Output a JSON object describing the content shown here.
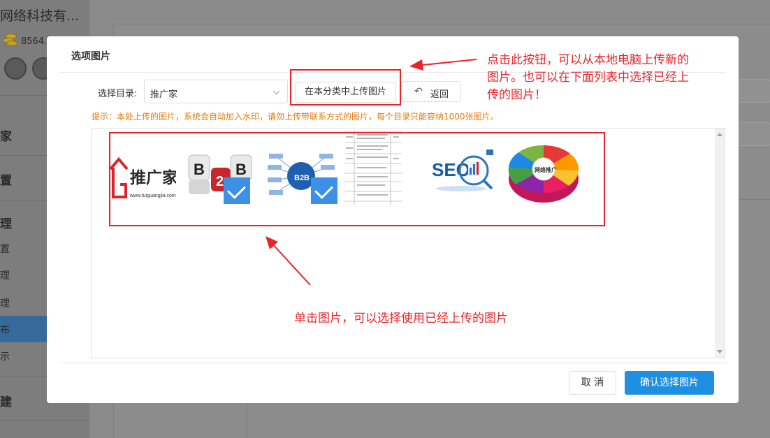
{
  "background": {
    "company_name": "网络科技有...",
    "balance": "8564.",
    "menu": [
      "家",
      "置",
      "理",
      "置",
      "理",
      "理",
      "布",
      "示",
      "建"
    ]
  },
  "modal": {
    "title": "选项图片",
    "directory_label": "选择目录:",
    "directory_value": "推广家",
    "upload_button": "在本分类中上传图片",
    "back_icon": "undo-arrow-icon",
    "back_button": "返回",
    "hint": "提示：本处上传的图片，系统会自动加入水印，请勿上传带联系方式的图片，每个目录只能容纳1000张图片。",
    "images": [
      {
        "name": "tuiguangjia-logo",
        "logo_text": "推广家",
        "url_text": "www.tuiguangjia.com",
        "selected": false
      },
      {
        "name": "b2b-cubes",
        "letters": [
          "B",
          "2",
          "B"
        ],
        "selected": true
      },
      {
        "name": "b2b-network",
        "label": "B2B",
        "selected": true
      },
      {
        "name": "document-table",
        "selected": false
      },
      {
        "name": "seo-chart",
        "label": "SEO",
        "selected": false
      },
      {
        "name": "network-promotion-wheel",
        "label": "网络推广",
        "selected": false
      }
    ],
    "cancel_button": "取 消",
    "confirm_button": "确认选择图片"
  },
  "annotations": {
    "top_note": [
      "点击此按钮，可以从本地电脑上传新的",
      "图片。也可以在下面列表中选择已经上",
      "传的图片！"
    ],
    "bottom_note": "单击图片，可以选择使用已经上传的图片",
    "color": "#e8242b"
  },
  "colors": {
    "primary": "#1e8fe1",
    "hint": "#e4780d",
    "check": "#3c91e6"
  }
}
